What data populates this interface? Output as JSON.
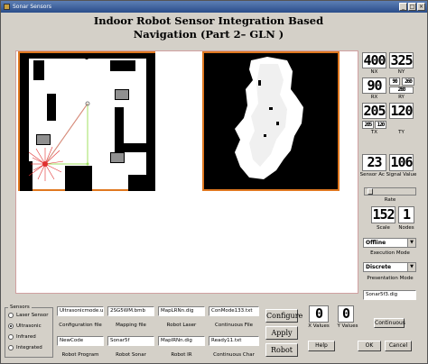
{
  "window": {
    "title": "Sonar Sensors",
    "controls": [
      "_",
      "□",
      "×"
    ]
  },
  "heading": {
    "line1": "Indoor Robot  Sensor  Integration Based",
    "line2": "Navigation (Part 2– GLN )"
  },
  "readouts": {
    "nx": {
      "value": "400",
      "label": "NX"
    },
    "ny": {
      "value": "325",
      "label": "NY"
    },
    "rx": {
      "value": "90",
      "label": "RX"
    },
    "ry": {
      "value": "260",
      "label": "RY"
    },
    "rx_small": "90",
    "ry_small": "260",
    "tx": {
      "value": "205",
      "label": "TX"
    },
    "ty": {
      "value": "120",
      "label": "TY"
    },
    "tx_small": "205",
    "ty_small": "120",
    "sensor_a": "23",
    "sensor_b": "106",
    "sensor_label": "Sensor Ac Signal Value",
    "rate_label": "Rate",
    "scale": {
      "value": "152",
      "label": "Scale"
    },
    "nodes": {
      "value": "1",
      "label": "Nodes"
    }
  },
  "execution": {
    "value": "Offline",
    "label": "Execution Mode"
  },
  "presentation": {
    "value": "Discrete",
    "label": "Presentation Mode"
  },
  "sonar_file": "Sonar5f3.dig",
  "sensors": {
    "label": "Sensors",
    "options": [
      {
        "label": "Laser Sensor",
        "selected": false
      },
      {
        "label": "Ultrasonic",
        "selected": true
      },
      {
        "label": "Infrared",
        "selected": false
      },
      {
        "label": "Integrated",
        "selected": false
      }
    ]
  },
  "files": {
    "config": {
      "value": "Ultrasonicmode.un-kur",
      "label": "Configuration file"
    },
    "mapping": {
      "value": "2SG5WM.bmb",
      "label": "Mapping file"
    },
    "robot_laser": {
      "value": "MapLRNn.dig",
      "label": "Robot Laser"
    },
    "continuous_file": {
      "value": "ConMode133.txt",
      "label": "Continuous File"
    },
    "robot_program": {
      "value": "NewCode",
      "label": "Robot Program"
    },
    "robot_sonar": {
      "value": "Sonar5f",
      "label": "Robot Sonar"
    },
    "robot_ir": {
      "value": "MapIRNn.dig",
      "label": "Robot IR"
    },
    "continuous_char": {
      "value": "Ready11.txt",
      "label": "Continuous Char"
    }
  },
  "buttons": {
    "configure": "Configure",
    "apply": "Apply",
    "robot": "Robot",
    "continuous": "Continuous",
    "help": "Help",
    "ok": "OK",
    "cancel": "Cancel"
  },
  "values": {
    "x": {
      "value": "0",
      "label": "X Values"
    },
    "y": {
      "value": "0",
      "label": "Y Values"
    }
  },
  "colors": {
    "map_border": "#e07820",
    "title_bar": "#2a4d8a",
    "sonar_rays": "#e03030",
    "path": "#a0e060"
  }
}
